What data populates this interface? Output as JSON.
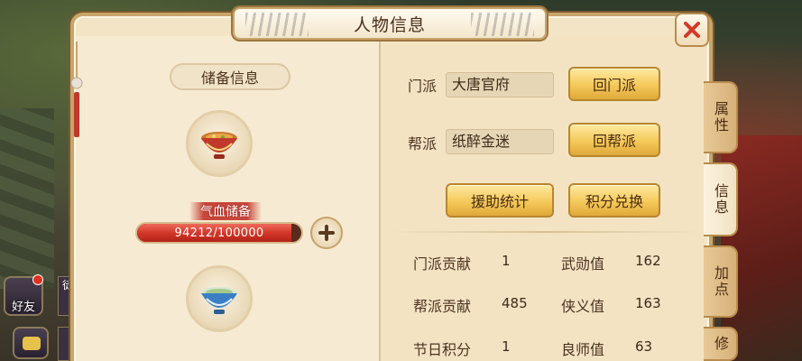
{
  "title": "人物信息",
  "reserve": {
    "header": "储备信息",
    "hp_label": "气血储备",
    "hp_text": "94212/100000",
    "hp_fraction": 0.94212
  },
  "sect": {
    "label": "门派",
    "value": "大唐官府",
    "button": "回门派"
  },
  "guild": {
    "label": "帮派",
    "value": "纸醉金迷",
    "button": "回帮派"
  },
  "actions": {
    "assist_stats": "援助统计",
    "points_exchange": "积分兑换"
  },
  "stats": [
    {
      "label": "门派贡献",
      "value": "1"
    },
    {
      "label": "武勋值",
      "value": "162"
    },
    {
      "label": "帮派贡献",
      "value": "485"
    },
    {
      "label": "侠义值",
      "value": "163"
    },
    {
      "label": "节日积分",
      "value": "1"
    },
    {
      "label": "良师值",
      "value": "63"
    }
  ],
  "tabs": [
    "属性",
    "信息",
    "加点",
    "修"
  ],
  "active_tab": "信息",
  "hud": {
    "friends_label": "好友",
    "side_label": "徒"
  },
  "colors": {
    "panel": "#f3e4c6",
    "button_gold": "#f4c95a",
    "hp_red": "#cf3426",
    "close_red": "#d23a2a"
  },
  "icons": [
    "close-icon",
    "plus-icon",
    "soup-bowl-icon",
    "tea-bowl-icon",
    "chat-icon"
  ]
}
